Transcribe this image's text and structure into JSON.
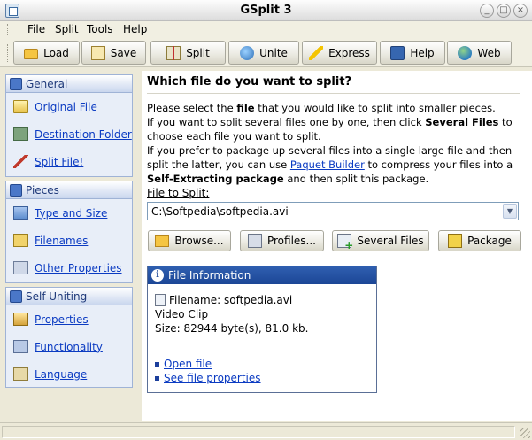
{
  "window": {
    "title": "GSplit 3",
    "controls": [
      "_",
      "□",
      "×"
    ]
  },
  "menu": [
    "File",
    "Split",
    "Tools",
    "Help"
  ],
  "toolbar": {
    "buttons": [
      {
        "label": "Load",
        "icon": "folder-icon"
      },
      {
        "label": "Save",
        "icon": "save-icon"
      },
      {
        "label": "Split",
        "icon": "split-icon"
      },
      {
        "label": "Unite",
        "icon": "unite-icon"
      },
      {
        "label": "Express",
        "icon": "lightning-icon"
      },
      {
        "label": "Help",
        "icon": "book-icon"
      },
      {
        "label": "Web",
        "icon": "globe-icon"
      }
    ]
  },
  "sidebar": {
    "sections": [
      {
        "title": "General",
        "items": [
          "Original File",
          "Destination Folder",
          "Split File!"
        ]
      },
      {
        "title": "Pieces",
        "items": [
          "Type and Size",
          "Filenames",
          "Other Properties"
        ]
      },
      {
        "title": "Self-Uniting",
        "items": [
          "Properties",
          "Functionality",
          "Language"
        ]
      }
    ]
  },
  "main": {
    "heading": "Which file do you want to split?",
    "desc": {
      "p1a": "Please select the ",
      "p1b": "file",
      "p1c": " that you would like to split into smaller pieces.",
      "p2a": "If you want to split several files one by one, then click ",
      "p2b": "Several Files",
      "p2c": " to choose each file you want to split.",
      "p3a": "If you prefer to package up several files into a single large file and then split the latter, you can use ",
      "p3b": "Paquet Builder",
      "p3c": " to compress your files into a ",
      "p3d": "Self-Extracting package",
      "p3e": " and then split this package."
    },
    "file_label": "File to Split:",
    "file_value": "C:\\Softpedia\\softpedia.avi",
    "actions": [
      "Browse...",
      "Profiles...",
      "Several Files",
      "Package"
    ],
    "info": {
      "title": "File Information",
      "filename_line": "Filename: softpedia.avi",
      "type_line": "Video Clip",
      "size_line": "Size: 82944 byte(s), 81.0 kb.",
      "links": [
        "Open file",
        "See file properties"
      ]
    }
  }
}
